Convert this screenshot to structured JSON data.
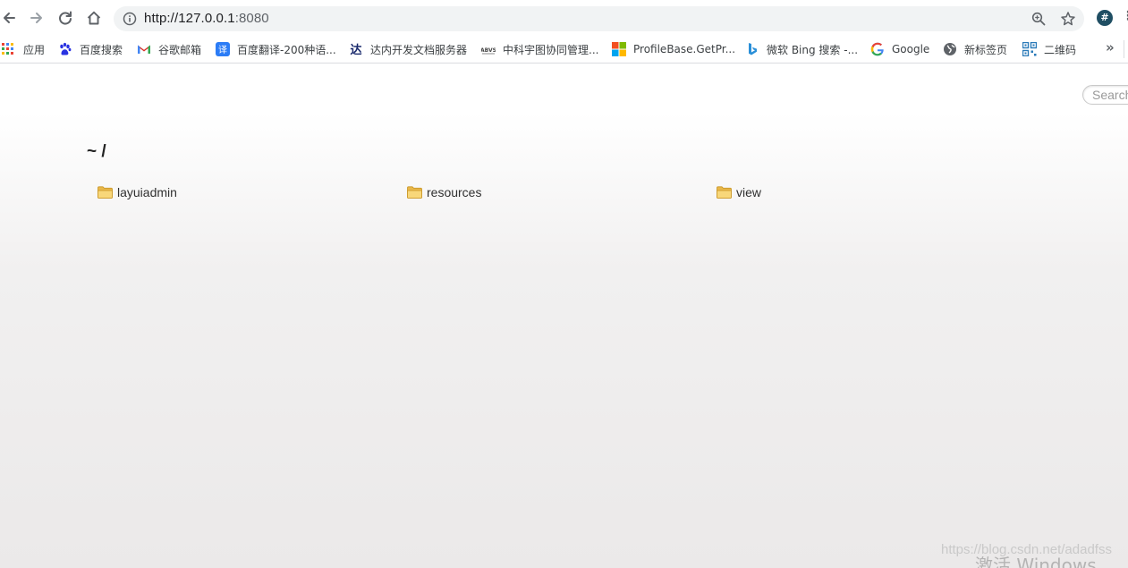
{
  "browser": {
    "url_host": "http://127.0.0.1",
    "url_port": ":8080",
    "extension_icon": "#"
  },
  "bookmarks": {
    "items": [
      {
        "label": "应用",
        "icon": "apps-grid-icon"
      },
      {
        "label": "百度搜索",
        "icon": "baidu-paw-icon"
      },
      {
        "label": "谷歌邮箱",
        "icon": "gmail-icon"
      },
      {
        "label": "百度翻译-200种语...",
        "icon": "translate-icon"
      },
      {
        "label": "达内开发文档服务器",
        "icon": "tarena-icon"
      },
      {
        "label": "中科宇图协同管理...",
        "icon": "mapuni-icon"
      },
      {
        "label": "ProfileBase.GetPr...",
        "icon": "microsoft-icon"
      },
      {
        "label": "微软 Bing 搜索 -...",
        "icon": "bing-icon"
      },
      {
        "label": "Google",
        "icon": "google-icon"
      },
      {
        "label": "新标签页",
        "icon": "globe-icon"
      },
      {
        "label": "二维码",
        "icon": "qrcode-icon"
      }
    ],
    "overflow": "»"
  },
  "page": {
    "search_placeholder": "Search",
    "breadcrumb": "~ /",
    "files": [
      {
        "name": "layuiadmin",
        "type": "folder"
      },
      {
        "name": "resources",
        "type": "folder"
      },
      {
        "name": "view",
        "type": "folder"
      }
    ]
  },
  "overlay": {
    "watermark": "https://blog.csdn.net/adadfss",
    "activate_windows": "激活 Windows"
  },
  "colors": {
    "omnibox_bg": "#f1f3f4",
    "folder_yellow": "#f2c760",
    "text_dark": "#303030"
  }
}
